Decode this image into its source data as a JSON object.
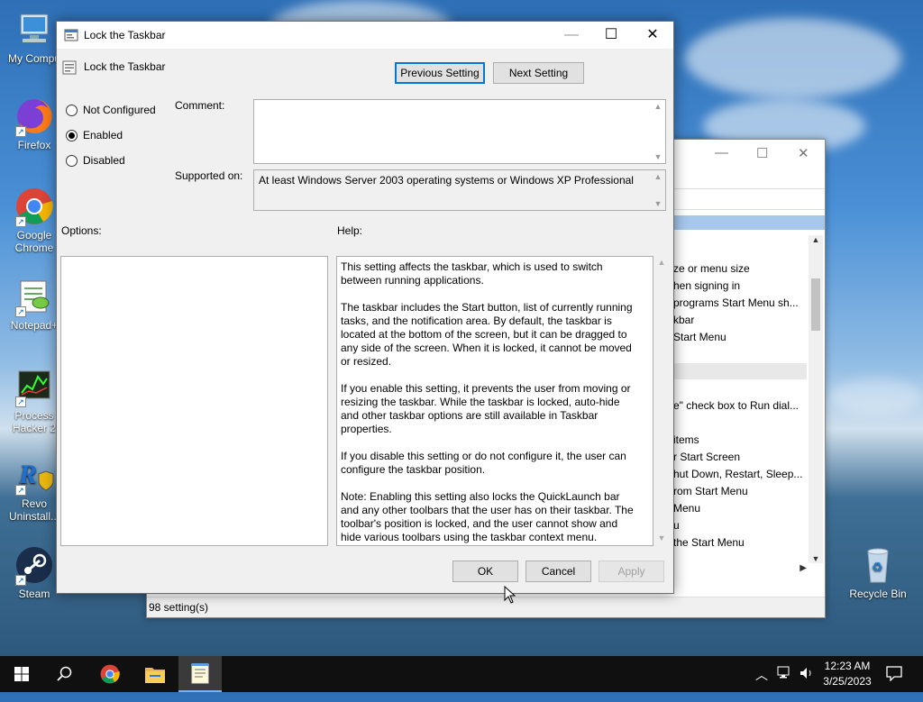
{
  "desktop": {
    "icons": [
      {
        "label": "My Compu",
        "icon": "computer-icon"
      },
      {
        "label": "Firefox",
        "icon": "firefox-icon"
      },
      {
        "label": "Google Chrome",
        "icon": "chrome-icon"
      },
      {
        "label": "Notepad+",
        "icon": "notepad-plus-icon"
      },
      {
        "label": "Process Hacker 2",
        "icon": "process-hacker-icon"
      },
      {
        "label": "Revo Uninstall...",
        "icon": "revo-icon"
      },
      {
        "label": "Steam",
        "icon": "steam-icon"
      },
      {
        "label": "Recycle Bin",
        "icon": "recycle-bin-icon"
      }
    ]
  },
  "background_window": {
    "list_items": [
      "ze or menu size",
      "hen signing in",
      "programs Start Menu sh...",
      "kbar",
      "Start Menu",
      "",
      "e\" check box to Run dial...",
      "",
      "items",
      "r Start Screen",
      "hut Down, Restart, Sleep...",
      "rom Start Menu",
      "Menu",
      "u",
      "the Start Menu"
    ],
    "status": "98 setting(s)"
  },
  "dialog": {
    "title": "Lock the Taskbar",
    "setting_name": "Lock the Taskbar",
    "previous_setting": "Previous Setting",
    "next_setting": "Next Setting",
    "radio_not_configured": "Not Configured",
    "radio_enabled": "Enabled",
    "radio_disabled": "Disabled",
    "comment_label": "Comment:",
    "supported_label": "Supported on:",
    "supported_value": "At least Windows Server 2003 operating systems or Windows XP Professional",
    "options_label": "Options:",
    "help_label": "Help:",
    "help_text": "This setting affects the taskbar, which is used to switch between running applications.\n\nThe taskbar includes the Start button, list of currently running tasks, and the notification area. By default, the taskbar is located at the bottom of the screen, but it can be dragged to any side of the screen. When it is locked, it cannot be moved or resized.\n\nIf you enable this setting, it prevents the user from moving or resizing the taskbar. While the taskbar is locked, auto-hide and other taskbar options are still available in Taskbar properties.\n\nIf you disable this setting or do not configure it, the user can configure the taskbar position.\n\nNote: Enabling this setting also locks the QuickLaunch bar and any other toolbars that the user has on their taskbar. The toolbar's position is locked, and the user cannot show and hide various toolbars using the taskbar context menu.",
    "ok": "OK",
    "cancel": "Cancel",
    "apply": "Apply",
    "selected_option": "Enabled"
  },
  "taskbar": {
    "time": "12:23 AM",
    "date": "3/25/2023"
  }
}
